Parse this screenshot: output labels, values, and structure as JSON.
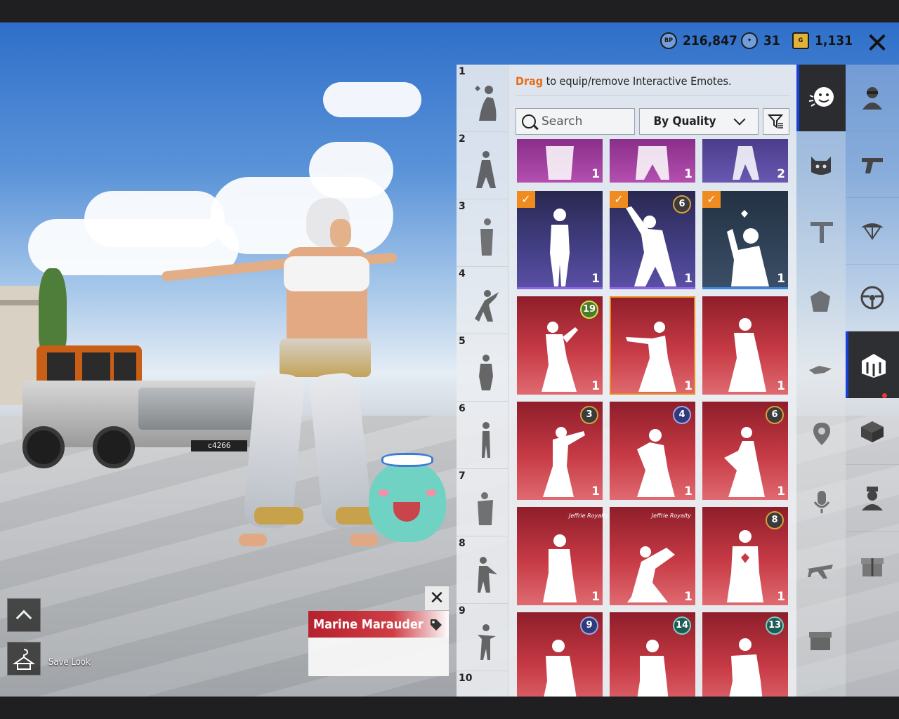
{
  "currency": [
    {
      "icon": "bp-coin-icon",
      "icon_text": "BP",
      "value": "216,847"
    },
    {
      "icon": "ag-coin-icon",
      "icon_text": "",
      "value": "31"
    },
    {
      "icon": "g-coin-icon",
      "icon_text": "G",
      "value": "1,131"
    }
  ],
  "close_label": "✕",
  "vehicle_plate": "c4266",
  "panel": {
    "hint_highlight": "Drag",
    "hint_rest": " to equip/remove Interactive Emotes.",
    "search_placeholder": "Search",
    "sort_value": "By Quality"
  },
  "slots": [
    "1",
    "2",
    "3",
    "4",
    "5",
    "6",
    "7",
    "8",
    "9",
    "10"
  ],
  "tiles": [
    {
      "count": "1"
    },
    {
      "count": "1"
    },
    {
      "count": "2"
    },
    {
      "count": "1",
      "checked": "✓"
    },
    {
      "count": "1",
      "checked": "✓",
      "level": "6"
    },
    {
      "count": "1",
      "checked": "✓"
    },
    {
      "count": "1",
      "level": "19"
    },
    {
      "count": "1"
    },
    {
      "count": "1"
    },
    {
      "count": "1",
      "level": "3"
    },
    {
      "count": "1",
      "level": "4"
    },
    {
      "count": "1",
      "level": "6"
    },
    {
      "count": "1"
    },
    {
      "count": "1"
    },
    {
      "count": "1",
      "level": "8"
    },
    {
      "count": "",
      "level": "9"
    },
    {
      "count": "",
      "level": "14"
    },
    {
      "count": "",
      "level": "13"
    }
  ],
  "tile_tags": {
    "t12": "Jeffrie Royalty",
    "t13": "Jeffrie Royalty"
  },
  "bottom": {
    "save_label": "Save Look"
  },
  "card": {
    "title": "Marine Marauder",
    "close": "✕"
  },
  "colors": {
    "accent": "#e86d1b",
    "tile_red": "#c63a45",
    "tile_blue": "#433f86",
    "nav_active": "#2a2c30",
    "nav_indicator": "#1642d6"
  }
}
